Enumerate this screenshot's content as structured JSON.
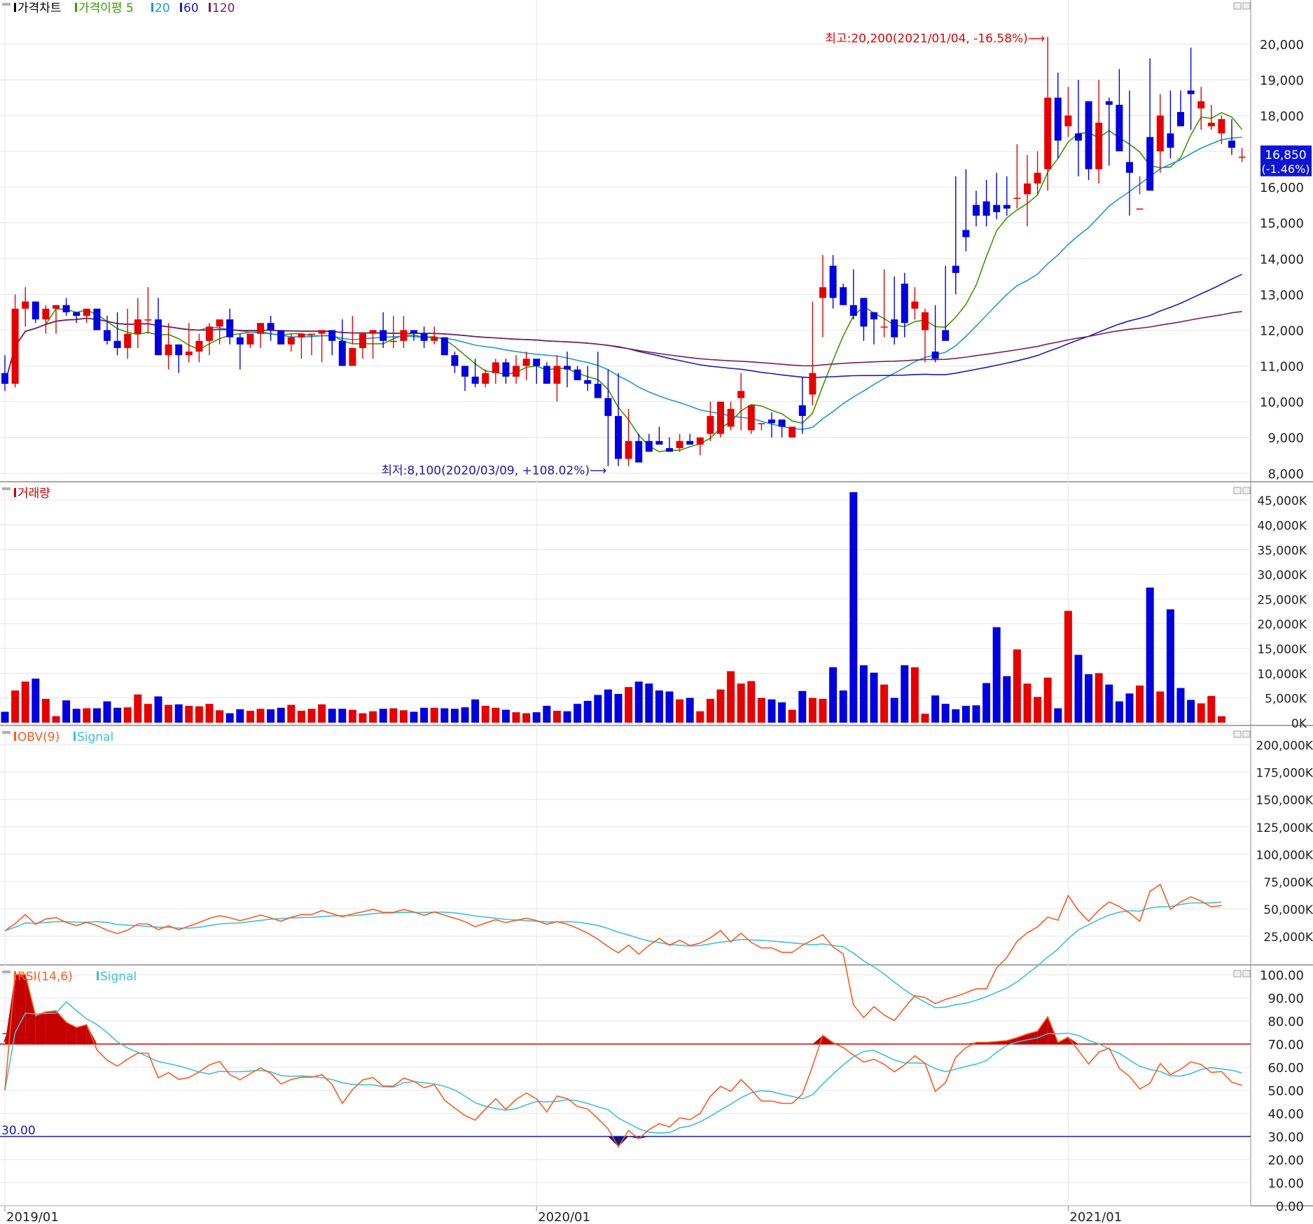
{
  "panels": {
    "price": {
      "legend": [
        {
          "label": "가격차트",
          "color": "#000000"
        },
        {
          "label": "가격이평 5",
          "color": "#3a9a00"
        },
        {
          "label": "20",
          "color": "#1f97d8"
        },
        {
          "label": "60",
          "color": "#1b1bb8"
        },
        {
          "label": "120",
          "color": "#7a1f55"
        }
      ],
      "y_ticks": [
        "20,000",
        "19,000",
        "18,000",
        "17,000",
        "16,000",
        "15,000",
        "14,000",
        "13,000",
        "12,000",
        "11,000",
        "10,000",
        "9,000",
        "8,000"
      ],
      "ylim": [
        7800,
        20800
      ],
      "high_annotation": "최고:20,200(2021/01/04, -16.58%)⟶",
      "low_annotation": "최저:8,100(2020/03/09, +108.02%)⟶",
      "current_price": "16,850",
      "current_change": "(-1.46%)"
    },
    "volume": {
      "legend": [
        {
          "label": "거래량",
          "color": "#cc0000"
        }
      ],
      "y_ticks": [
        "45,000K",
        "40,000K",
        "35,000K",
        "30,000K",
        "25,000K",
        "20,000K",
        "15,000K",
        "10,000K",
        "5,000K",
        "0K"
      ],
      "ylim": [
        0,
        47000
      ]
    },
    "obv": {
      "legend": [
        {
          "label": "OBV(9)",
          "color": "#ff5a1f"
        },
        {
          "label": "Signal",
          "color": "#3cc2d8"
        }
      ],
      "y_ticks": [
        "200,000K",
        "175,000K",
        "150,000K",
        "125,000K",
        "100,000K",
        "75,000K",
        "50,000K",
        "25,000K"
      ],
      "ylim": [
        0,
        210000
      ]
    },
    "rsi": {
      "legend": [
        {
          "label": "RSI(14,6)",
          "color": "#ff5a1f"
        },
        {
          "label": "Signal",
          "color": "#3cc2d8"
        }
      ],
      "y_ticks": [
        "100.00",
        "90.00",
        "80.00",
        "70.00",
        "60.00",
        "50.00",
        "40.00",
        "30.00",
        "20.00",
        "10.00",
        "0.00"
      ],
      "upper_label": "70.00",
      "lower_label": "30.00",
      "ylim": [
        0,
        100
      ]
    }
  },
  "x_axis": {
    "labels": [
      {
        "text": "2019/01",
        "index": 0
      },
      {
        "text": "2020/01",
        "index": 52
      },
      {
        "text": "2021/01",
        "index": 104
      }
    ]
  },
  "chart_data": {
    "type": "candlestick",
    "interval": "weekly",
    "open": [
      10800,
      10500,
      12600,
      12800,
      12300,
      12600,
      12700,
      12500,
      12400,
      12600,
      12000,
      11700,
      11500,
      11900,
      12300,
      12300,
      11300,
      11600,
      11300,
      11400,
      11700,
      12100,
      12300,
      11800,
      11600,
      11900,
      12200,
      12000,
      11600,
      11800,
      11900,
      11900,
      12000,
      11700,
      11000,
      11500,
      11900,
      12000,
      11700,
      11700,
      12000,
      11900,
      11700,
      11800,
      11300,
      11000,
      10700,
      10500,
      10800,
      11100,
      10700,
      11000,
      11200,
      11000,
      10500,
      11000,
      10900,
      10600,
      10500,
      10100,
      9600,
      8400,
      8900,
      8900,
      8900,
      8700,
      8700,
      8900,
      8800,
      9100,
      9100,
      9300,
      10100,
      9200,
      9400,
      9500,
      9500,
      9000,
      9900,
      10200,
      12900,
      13800,
      13200,
      12700,
      12900,
      12500,
      12100,
      12300,
      13300,
      12600,
      12000,
      11400,
      12000,
      13800,
      14800,
      15500,
      15600,
      15500,
      15500,
      15700,
      15800,
      16100,
      16500,
      18500,
      17700,
      17500,
      18400,
      16500,
      18400,
      18300,
      16700,
      15400,
      17400,
      17000,
      17500,
      18100,
      18700,
      18200,
      17700,
      17500,
      17300,
      16850
    ],
    "high": [
      11300,
      13000,
      13200,
      12800,
      12700,
      12700,
      12900,
      12500,
      12500,
      12600,
      12400,
      12500,
      12600,
      12900,
      13200,
      12900,
      12200,
      11600,
      12200,
      11900,
      12200,
      12100,
      12600,
      11900,
      11700,
      12200,
      12400,
      12000,
      11900,
      11800,
      11900,
      12000,
      12000,
      12300,
      12400,
      11900,
      12000,
      12500,
      12400,
      12400,
      12000,
      12100,
      12100,
      11800,
      11400,
      11000,
      11200,
      10900,
      11200,
      11200,
      11300,
      11400,
      11100,
      11100,
      11300,
      11400,
      11000,
      11000,
      11400,
      10900,
      10800,
      9800,
      9100,
      9100,
      9300,
      9000,
      9100,
      9100,
      9000,
      10000,
      9700,
      10000,
      10800,
      9900,
      9400,
      9700,
      9400,
      9200,
      10700,
      12800,
      14100,
      14100,
      13300,
      13700,
      12900,
      12300,
      13700,
      13500,
      13600,
      13200,
      12600,
      12700,
      13800,
      16300,
      16500,
      15900,
      16200,
      16400,
      16300,
      17200,
      16900,
      17000,
      20200,
      19200,
      18800,
      19000,
      18400,
      19000,
      18500,
      19300,
      18700,
      16300,
      19600,
      18600,
      18700,
      18700,
      19900,
      18800,
      18300,
      18000,
      17900,
      17100
    ],
    "low": [
      10300,
      10400,
      12100,
      12200,
      11900,
      11900,
      12400,
      12200,
      12200,
      12400,
      11600,
      11300,
      11200,
      11500,
      11900,
      11800,
      10900,
      10800,
      11100,
      11100,
      11300,
      11600,
      11600,
      10900,
      11500,
      11500,
      11700,
      11700,
      11400,
      11200,
      11300,
      11100,
      11300,
      11300,
      11600,
      11200,
      11200,
      11500,
      11500,
      11500,
      11700,
      11500,
      11600,
      11600,
      10800,
      10300,
      10400,
      10400,
      10500,
      10500,
      10500,
      10600,
      10500,
      10500,
      10000,
      10400,
      10600,
      10300,
      10200,
      8200,
      8200,
      8200,
      8500,
      8800,
      8900,
      8600,
      8600,
      8800,
      8500,
      8900,
      9000,
      9200,
      9200,
      9100,
      9200,
      9000,
      9000,
      9000,
      9100,
      9900,
      11800,
      12600,
      12700,
      12300,
      11700,
      11600,
      11800,
      11600,
      11800,
      12300,
      11100,
      11100,
      11900,
      13000,
      14200,
      14900,
      14900,
      15100,
      15200,
      15400,
      14900,
      15800,
      15900,
      16800,
      17400,
      16300,
      16200,
      16100,
      16600,
      17100,
      15200,
      15800,
      16000,
      16400,
      16800,
      17700,
      17600,
      17600,
      17600,
      17200,
      16900,
      16700
    ],
    "close": [
      10500,
      12600,
      12800,
      12300,
      12600,
      12700,
      12500,
      12400,
      12600,
      12000,
      11700,
      11500,
      11900,
      12300,
      12300,
      11300,
      11600,
      11300,
      11400,
      11700,
      12100,
      12300,
      11800,
      11600,
      11900,
      12200,
      12000,
      11600,
      11800,
      11900,
      11900,
      12000,
      11700,
      11000,
      11500,
      11900,
      12000,
      11700,
      11700,
      12000,
      11900,
      11700,
      11800,
      11300,
      11000,
      10700,
      10500,
      10800,
      11100,
      10700,
      11000,
      11200,
      11000,
      10500,
      11000,
      10900,
      10600,
      10500,
      10100,
      9600,
      8400,
      8900,
      8300,
      8600,
      8800,
      8600,
      8900,
      8800,
      9000,
      9600,
      10000,
      9800,
      10300,
      9900,
      9400,
      9400,
      9300,
      9300,
      9600,
      10800,
      13200,
      12900,
      12700,
      12400,
      12100,
      12300,
      12100,
      11800,
      12200,
      12800,
      12500,
      11200,
      11700,
      13600,
      14600,
      15200,
      15200,
      15300,
      15400,
      15700,
      16100,
      16400,
      18500,
      17300,
      18000,
      17300,
      16500,
      17800,
      18300,
      17000,
      16400,
      15400,
      15900,
      18000,
      17100,
      17700,
      18600,
      18400,
      17800,
      17900,
      17100,
      16850
    ],
    "volume": [
      2200,
      6500,
      8300,
      8900,
      4800,
      1300,
      4500,
      2800,
      2900,
      2900,
      4300,
      3000,
      3100,
      5700,
      3800,
      5300,
      3600,
      3700,
      3400,
      3300,
      3800,
      2500,
      1900,
      2700,
      2400,
      2800,
      2700,
      3000,
      3600,
      2400,
      2800,
      3700,
      2800,
      2800,
      2600,
      1900,
      2300,
      2800,
      2900,
      2500,
      2200,
      3000,
      3000,
      2900,
      2800,
      3100,
      4700,
      3400,
      3000,
      2600,
      2100,
      1900,
      2100,
      3400,
      2400,
      2300,
      3800,
      4400,
      5600,
      6700,
      5800,
      7200,
      8300,
      7900,
      6500,
      6300,
      4700,
      5000,
      2300,
      4800,
      6700,
      10400,
      7900,
      8400,
      5000,
      4700,
      4100,
      2600,
      6400,
      5000,
      4800,
      11200,
      6500,
      46600,
      11600,
      10100,
      7700,
      5000,
      11600,
      11200,
      1800,
      5500,
      3800,
      2700,
      3400,
      3500,
      8000,
      19300,
      9400,
      14800,
      7900,
      5200,
      9100,
      2900,
      22600,
      13700,
      9800,
      10000,
      7700,
      4300,
      5900,
      7500,
      27300,
      6300,
      22900,
      7000,
      4600,
      3900,
      5400,
      1300
    ]
  }
}
